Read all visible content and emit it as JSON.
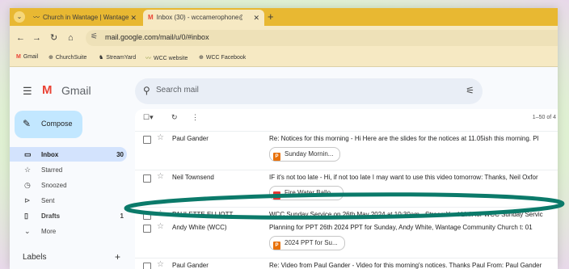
{
  "browser": {
    "tabs": [
      {
        "favicon": "church-favicon",
        "title": "Church in Wantage | Wantage C",
        "active": false
      },
      {
        "favicon": "gmail-favicon",
        "title": "Inbox (30) - wccamerophone@",
        "active": true
      }
    ],
    "new_tab": "+",
    "url": "mail.google.com/mail/u/0/#inbox",
    "bookmarks": [
      "Gmail",
      "ChurchSuite",
      "StreamYard",
      "WCC website",
      "WCC Facebook"
    ]
  },
  "gmail": {
    "logo_text": "Gmail",
    "search_placeholder": "Search mail",
    "compose_label": "Compose",
    "nav": [
      {
        "icon": "inbox-icon",
        "label": "Inbox",
        "count": "30",
        "active": true
      },
      {
        "icon": "star-icon",
        "label": "Starred",
        "count": ""
      },
      {
        "icon": "clock-icon",
        "label": "Snoozed",
        "count": ""
      },
      {
        "icon": "send-icon",
        "label": "Sent",
        "count": ""
      },
      {
        "icon": "draft-icon",
        "label": "Drafts",
        "count": "1"
      },
      {
        "icon": "chevron-down-icon",
        "label": "More",
        "count": ""
      }
    ],
    "labels_heading": "Labels",
    "pager_text": "1–50 of 4",
    "emails": [
      {
        "sender": "Paul Gander",
        "subject": "Re: Notices for this morning - Hi Here are the slides for the notices at 11.05ish this morning. Pl",
        "attachment": "Sunday Mornin...",
        "attachment_type": "P"
      },
      {
        "sender": "Neil Townsend",
        "subject": "IF it's not too late - Hi, if not too late I may want to use this video tomorrow: Thanks, Neil Oxfor",
        "attachment": "Fire Water Ballo...",
        "attachment_type": "video"
      },
      {
        "sender": "PAULETTE ELLIOTT",
        "subject": "WCC Sunday Service on 26th May 2024 at 10:30am - StreamYard Link for WCC Sunday Servic",
        "attachment": "",
        "attachment_type": ""
      },
      {
        "sender": "Andy White (WCC)",
        "subject": "Planning for PPT 26th 2024 PPT for Sunday, Andy White, Wantage Community Church t: 01",
        "attachment": "2024 PPT for Su...",
        "attachment_type": "P"
      },
      {
        "sender": "Paul Gander",
        "subject": "Re: Video from Paul Gander - Video for this morning's notices. Thanks Paul From: Paul Gander",
        "attachment": "",
        "attachment_type": ""
      }
    ]
  },
  "annotation": {
    "shape": "ellipse",
    "color": "#0b7a6a",
    "target": "PAULETTE ELLIOTT row"
  }
}
